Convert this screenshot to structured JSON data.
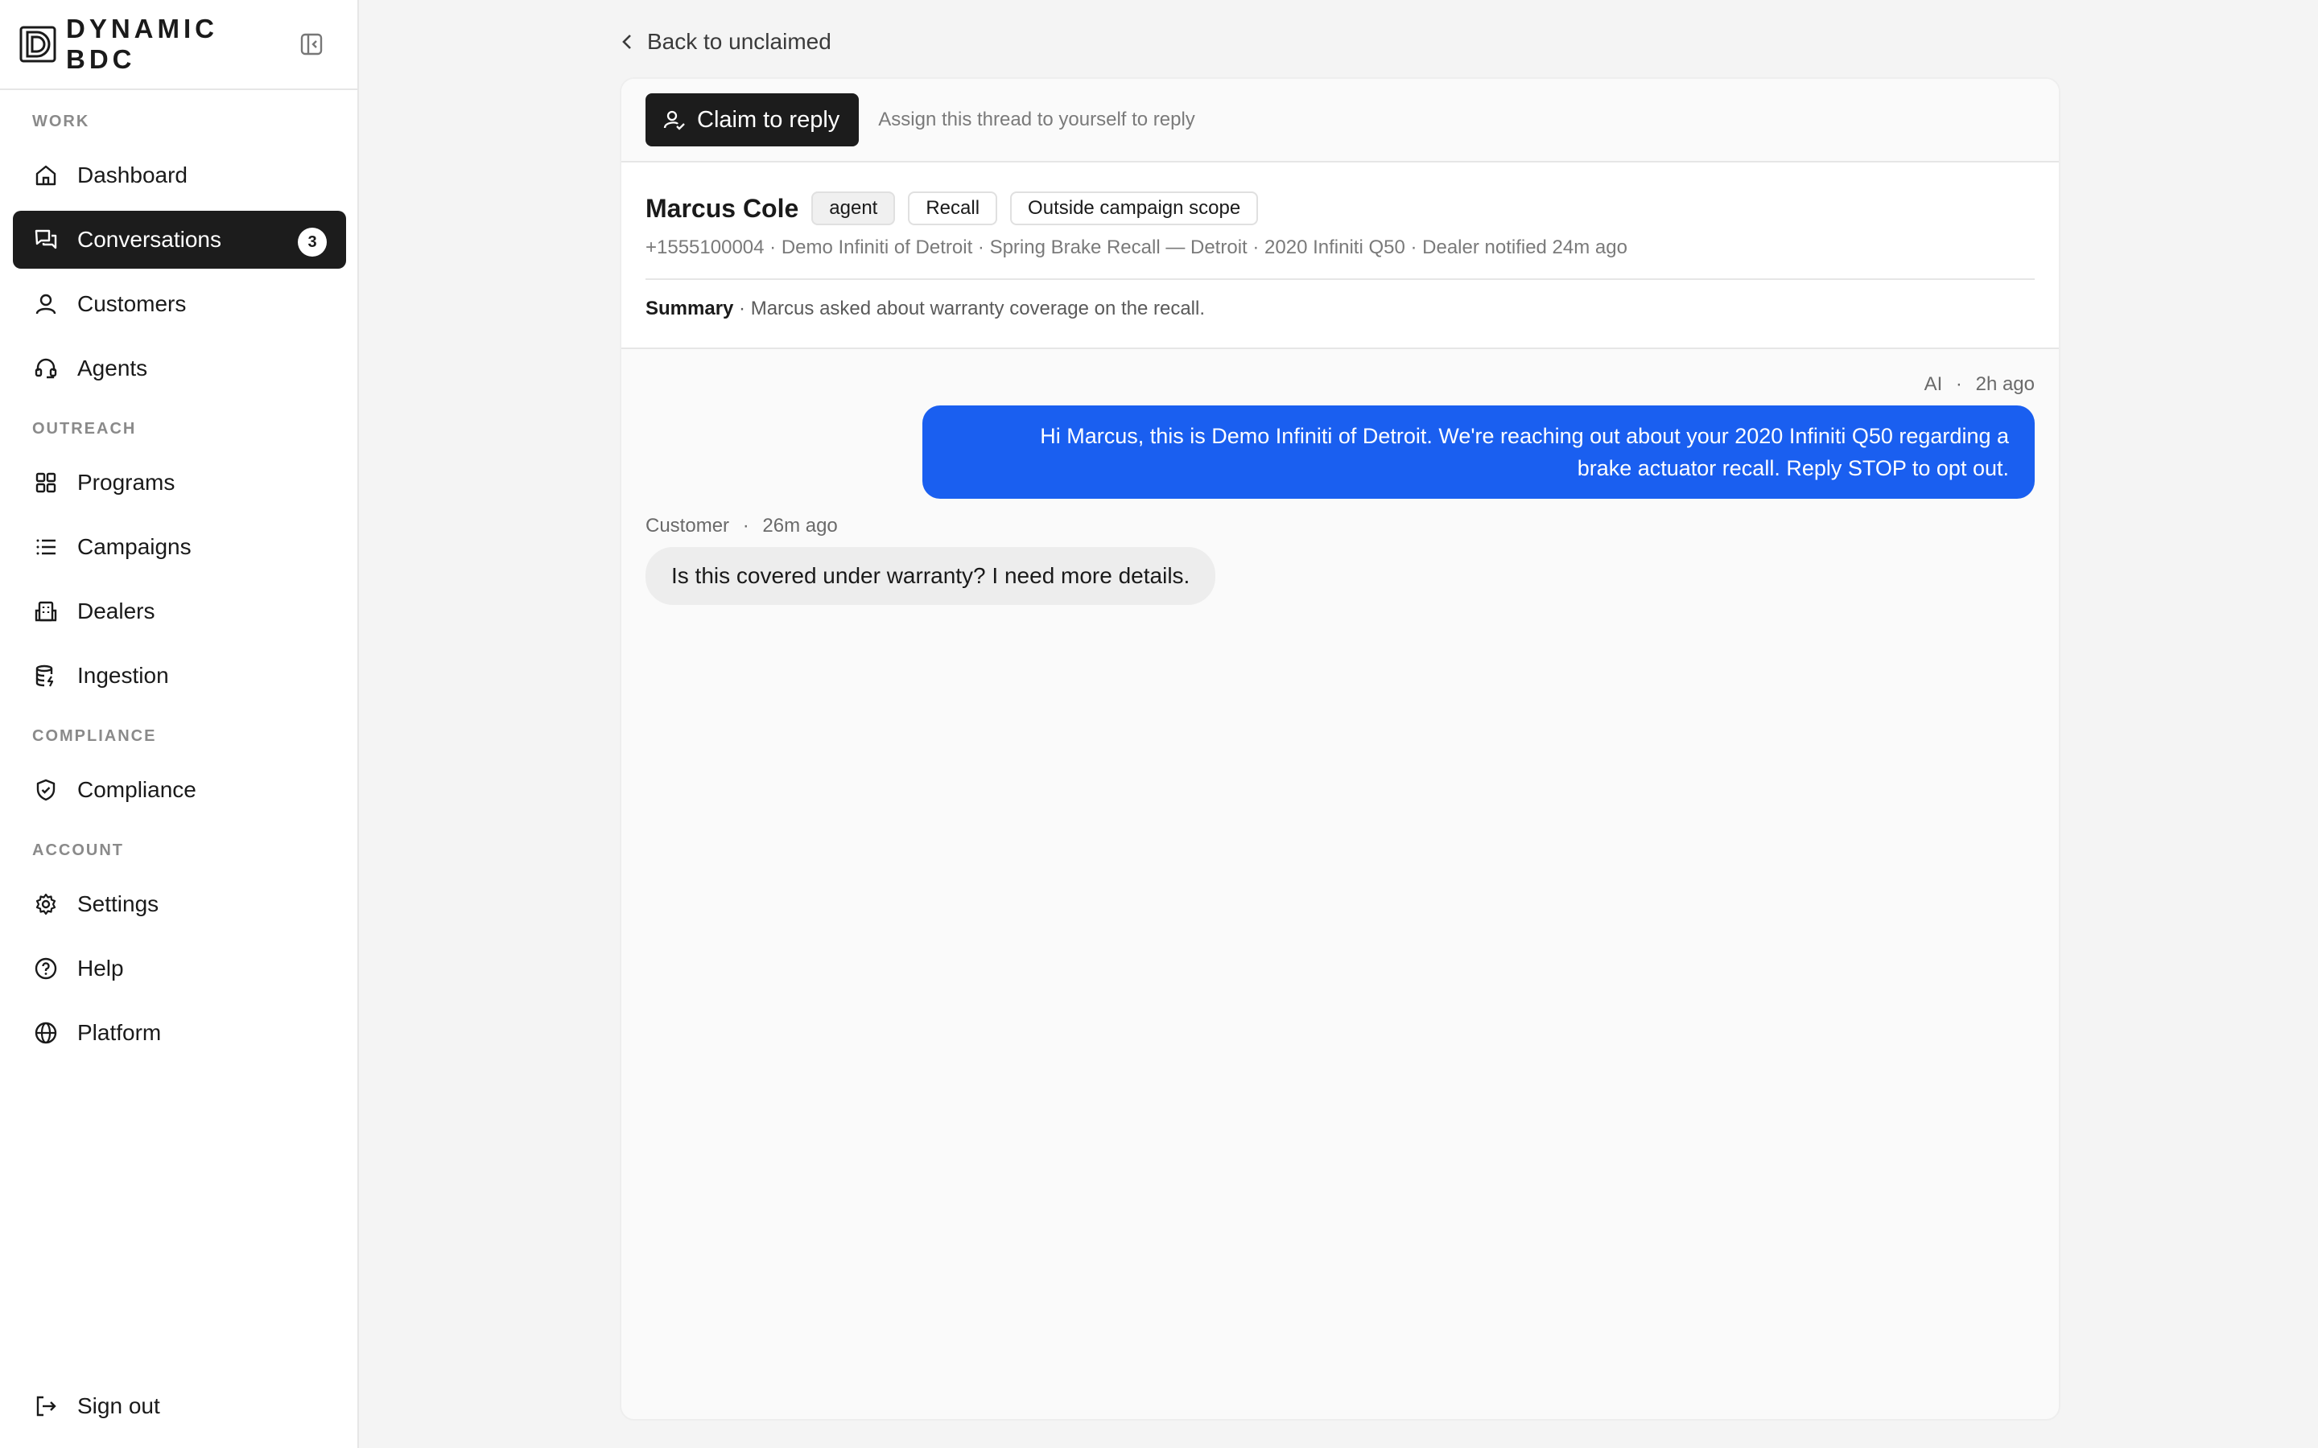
{
  "brand": {
    "name": "DYNAMIC BDC"
  },
  "sidebar": {
    "sections": {
      "work": "WORK",
      "outreach": "OUTREACH",
      "compliance": "COMPLIANCE",
      "account": "ACCOUNT"
    },
    "items": {
      "dashboard": {
        "label": "Dashboard",
        "icon": "home-icon"
      },
      "conversations": {
        "label": "Conversations",
        "icon": "chat-icon",
        "badge": "3",
        "active": true
      },
      "customers": {
        "label": "Customers",
        "icon": "user-icon"
      },
      "agents": {
        "label": "Agents",
        "icon": "headset-icon"
      },
      "programs": {
        "label": "Programs",
        "icon": "grid-icon"
      },
      "campaigns": {
        "label": "Campaigns",
        "icon": "list-icon"
      },
      "dealers": {
        "label": "Dealers",
        "icon": "building-icon"
      },
      "ingestion": {
        "label": "Ingestion",
        "icon": "database-icon"
      },
      "compliance": {
        "label": "Compliance",
        "icon": "shield-icon"
      },
      "settings": {
        "label": "Settings",
        "icon": "gear-icon"
      },
      "help": {
        "label": "Help",
        "icon": "help-icon"
      },
      "platform": {
        "label": "Platform",
        "icon": "globe-icon"
      },
      "signout": {
        "label": "Sign out",
        "icon": "sign-out-icon"
      }
    }
  },
  "main": {
    "back_label": "Back to unclaimed",
    "claim_label": "Claim to reply",
    "claim_hint": "Assign this thread to yourself to reply",
    "customer": {
      "name": "Marcus Cole",
      "tags": [
        "agent",
        "Recall",
        "Outside campaign scope"
      ],
      "meta": "+1555100004 · Demo Infiniti of Detroit · Spring Brake Recall — Detroit · 2020 Infiniti Q50 · Dealer notified 24m ago",
      "summary_label": "Summary",
      "summary_text": " · Marcus asked about warranty coverage on the recall."
    },
    "messages": [
      {
        "sender": "AI",
        "time": "2h ago",
        "line1": "Hi Marcus, this is Demo Infiniti of Detroit. We're reaching out about your 2020 Infiniti Q50 regarding a",
        "line2": "brake actuator recall. Reply STOP to opt out."
      },
      {
        "sender": "Customer",
        "time": "26m ago",
        "text": "Is this covered under warranty? I need more details."
      }
    ]
  },
  "colors": {
    "accent": "#1a5ff0",
    "active_nav": "#1c1c1c",
    "muted_text": "#7a7a7a"
  }
}
